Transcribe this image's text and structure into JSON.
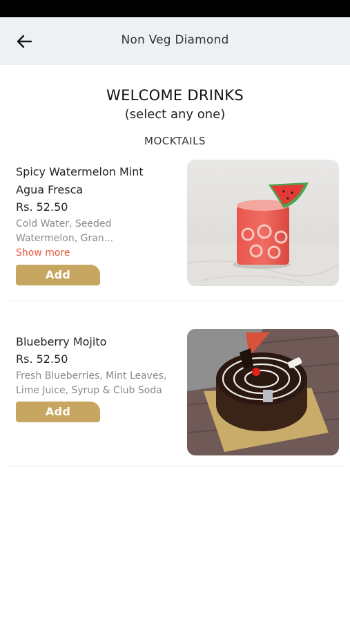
{
  "header": {
    "title": "Non Veg Diamond",
    "back_icon": "arrow-left-icon"
  },
  "section": {
    "title": "WELCOME DRINKS",
    "subtitle": "(select any one)",
    "category": "MOCKTAILS"
  },
  "items": [
    {
      "name": "Spicy Watermelon Mint Agua Fresca",
      "price": "Rs. 52.50",
      "description": "Cold Water, Seeded Watermelon, Gran...",
      "show_more": "Show more",
      "add_label": "Add",
      "image": "watermelon-drink-image"
    },
    {
      "name": "Blueberry Mojito",
      "price": "Rs. 52.50",
      "description": "Fresh Blueberries, Mint Leaves, Lime Juice, Syrup & Club Soda",
      "add_label": "Add",
      "image": "chocolate-cake-image"
    }
  ],
  "colors": {
    "accent": "#c7a661",
    "link": "#e35b3d",
    "app_bar": "#eef1f3"
  }
}
